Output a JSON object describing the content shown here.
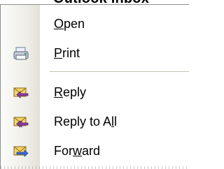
{
  "header": {
    "title": "Outlook Inbox"
  },
  "menu": {
    "items": [
      {
        "before": "",
        "key": "O",
        "after": "pen",
        "icon": "none"
      },
      {
        "before": "",
        "key": "P",
        "after": "rint",
        "icon": "printer-icon"
      },
      {
        "before": "",
        "key": "R",
        "after": "eply",
        "icon": "reply-mail-icon"
      },
      {
        "before": "Reply to A",
        "key": "l",
        "after": "l",
        "icon": "reply-all-mail-icon"
      },
      {
        "before": "For",
        "key": "w",
        "after": "ard",
        "icon": "forward-mail-icon"
      }
    ]
  },
  "colors": {
    "gutter": "#eeede6",
    "separator": "#c5c2b8",
    "reply_arrow": "#8a3ba7",
    "forward_arrow": "#3c6bd8",
    "envelope": "#f2d36a"
  }
}
